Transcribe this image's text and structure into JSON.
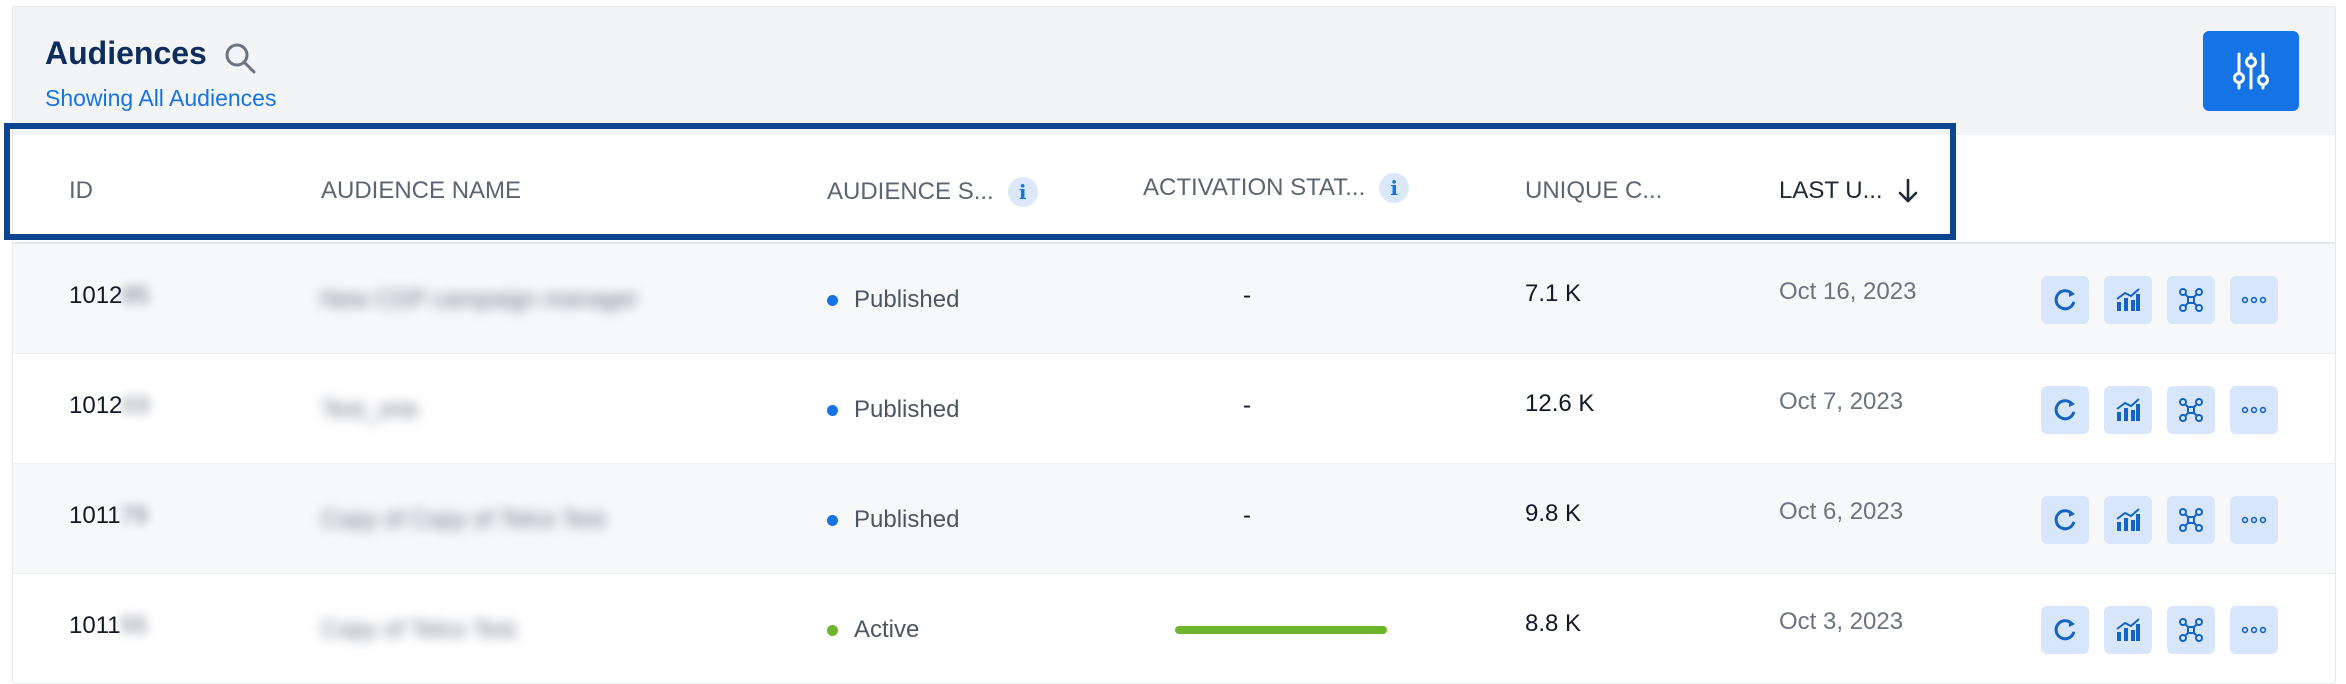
{
  "header": {
    "title": "Audiences",
    "subtitle": "Showing All Audiences"
  },
  "columns": {
    "id": "ID",
    "name": "AUDIENCE NAME",
    "status": "AUDIENCE S...",
    "activation": "ACTIVATION STAT...",
    "unique": "UNIQUE C...",
    "updated": "LAST U..."
  },
  "info_glyph": "i",
  "rows": [
    {
      "id_visible": "1012",
      "id_hidden": "85",
      "name": "New CDP campaign manager",
      "status": "Published",
      "status_color": "#1673e6",
      "activation": "-",
      "unique": "7.1 K",
      "updated": "Oct 16, 2023"
    },
    {
      "id_visible": "1012",
      "id_hidden": "03",
      "name": "Test_one",
      "status": "Published",
      "status_color": "#1673e6",
      "activation": "-",
      "unique": "12.6 K",
      "updated": "Oct 7, 2023"
    },
    {
      "id_visible": "1011",
      "id_hidden": "79",
      "name": "Copy of Copy of Telco Test",
      "status": "Published",
      "status_color": "#1673e6",
      "activation": "-",
      "unique": "9.8 K",
      "updated": "Oct 6, 2023"
    },
    {
      "id_visible": "1011",
      "id_hidden": "55",
      "name": "Copy of Telco Test",
      "status": "Active",
      "status_color": "#6cb52d",
      "activation_progress": 1.0,
      "unique": "8.8 K",
      "updated": "Oct 3, 2023"
    }
  ],
  "colors": {
    "accent": "#1673e6",
    "title": "#0c2d5e",
    "highlight_border": "#0d4593",
    "published": "#1673e6",
    "active": "#6cb52d"
  },
  "icons": {
    "search": "search-icon",
    "filter": "sliders-icon",
    "sort": "arrow-down-icon",
    "actions": [
      "refresh-icon",
      "analytics-icon",
      "network-icon",
      "more-icon"
    ]
  }
}
